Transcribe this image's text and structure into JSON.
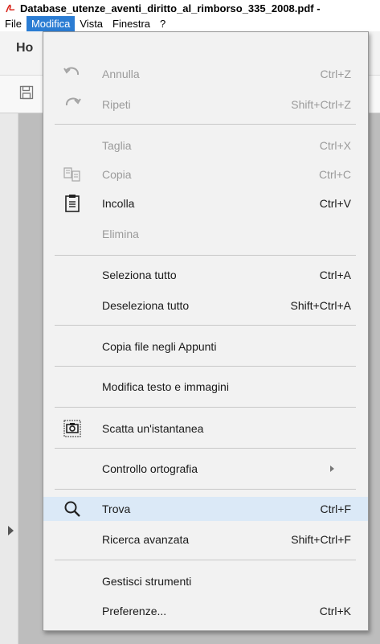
{
  "window": {
    "title": "Database_utenze_aventi_diritto_al_rimborso_335_2008.pdf -"
  },
  "menubar": {
    "items": [
      "File",
      "Modifica",
      "Vista",
      "Finestra",
      "?"
    ]
  },
  "toolbar": {
    "home_tab": "Ho"
  },
  "menu": {
    "items": [
      {
        "label": "Annulla",
        "shortcut": "Ctrl+Z",
        "icon": "undo-icon"
      },
      {
        "label": "Ripeti",
        "shortcut": "Shift+Ctrl+Z",
        "icon": "redo-icon"
      },
      {
        "label": "Taglia",
        "shortcut": "Ctrl+X"
      },
      {
        "label": "Copia",
        "shortcut": "Ctrl+C",
        "icon": "copy-icon"
      },
      {
        "label": "Incolla",
        "shortcut": "Ctrl+V",
        "icon": "paste-icon"
      },
      {
        "label": "Elimina",
        "shortcut": ""
      },
      {
        "label": "Seleziona tutto",
        "shortcut": "Ctrl+A"
      },
      {
        "label": "Deseleziona tutto",
        "shortcut": "Shift+Ctrl+A"
      },
      {
        "label": "Copia file negli Appunti",
        "shortcut": ""
      },
      {
        "label": "Modifica testo e immagini",
        "shortcut": ""
      },
      {
        "label": "Scatta un'istantanea",
        "shortcut": "",
        "icon": "snapshot-camera-icon"
      },
      {
        "label": "Controllo ortografia",
        "shortcut": ""
      },
      {
        "label": "Trova",
        "shortcut": "Ctrl+F",
        "icon": "search-icon"
      },
      {
        "label": "Ricerca avanzata",
        "shortcut": "Shift+Ctrl+F"
      },
      {
        "label": "Gestisci strumenti",
        "shortcut": ""
      },
      {
        "label": "Preferenze...",
        "shortcut": "Ctrl+K"
      }
    ]
  }
}
